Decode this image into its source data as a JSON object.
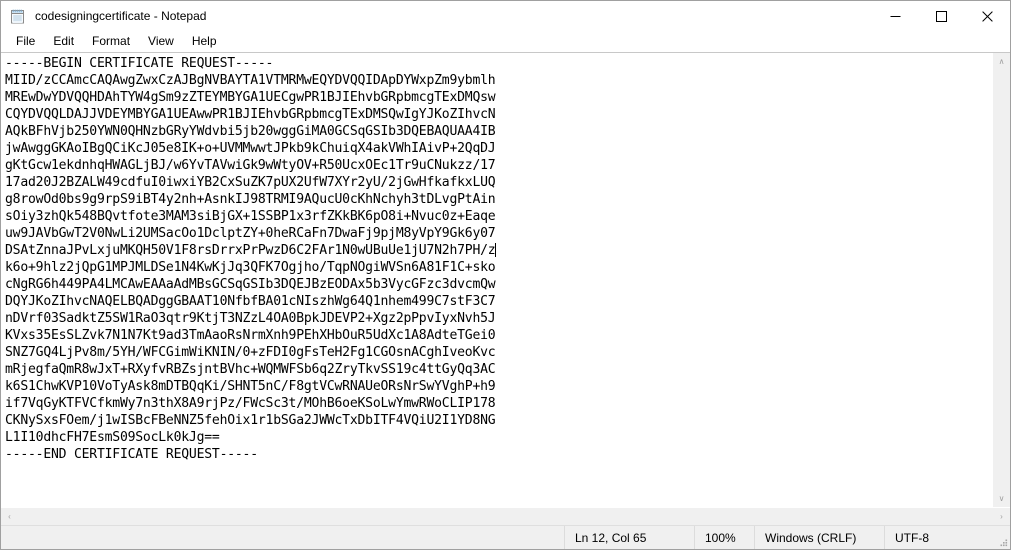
{
  "window": {
    "title": "codesigningcertificate - Notepad",
    "app_icon": "notepad-icon",
    "minimize_label": "Minimize",
    "maximize_label": "Maximize",
    "close_label": "Close"
  },
  "menubar": {
    "items": [
      {
        "label": "File"
      },
      {
        "label": "Edit"
      },
      {
        "label": "Format"
      },
      {
        "label": "View"
      },
      {
        "label": "Help"
      }
    ]
  },
  "editor": {
    "caret_line_index": 12,
    "lines": [
      "-----BEGIN CERTIFICATE REQUEST-----",
      "MIID/zCCAmcCAQAwgZwxCzAJBgNVBAYTA1VTMRMwEQYDVQQIDApDYWxpZm9ybmlh",
      "MREwDwYDVQQHDAhTYW4gSm9zZTEYMBYGA1UECgwPR1BJIEhvbGRpbmcgTExDMQsw",
      "CQYDVQQLDAJJVDEYMBYGA1UEAwwPR1BJIEhvbGRpbmcgTExDMSQwIgYJKoZIhvcN",
      "AQkBFhVjb250YWN0QHNzbGRyYWdvbi5jb20wggGiMA0GCSqGSIb3DQEBAQUAA4IB",
      "jwAwggGKAoIBgQCiKcJ05e8IK+o+UVMMwwtJPkb9kChuiqX4akVWhIAivP+2QqDJ",
      "gKtGcw1ekdnhqHWAGLjBJ/w6YvTAVwiGk9wWtyOV+R50UcxOEc1Tr9uCNukzz/17",
      "17ad20J2BZALW49cdfuI0iwxiYB2CxSuZK7pUX2UfW7XYr2yU/2jGwHfkafkxLUQ",
      "g8rowOd0bs9g9rpS9iBT4y2nh+AsnkIJ98TRMI9AQucU0cKhNchyh3tDLvgPtAin",
      "sOiy3zhQk548BQvtfote3MAM3siBjGX+1SSBP1x3rfZKkBK6pO8i+Nvuc0z+Eaqe",
      "uw9JAVbGwT2V0NwLi2UMSacOo1DclptZY+0heRCaFn7DwaFj9pjM8yVpY9Gk6y07",
      "DSAtZnnaJPvLxjuMKQH50V1F8rsDrrxPrPwzD6C2FAr1N0wUBuUe1jU7N2h7PH/z",
      "k6o+9hlz2jQpG1MPJMLDSe1N4KwKjJq3QFK7Ogjho/TqpNOgiWVSn6A81F1C+sko",
      "cNgRG6h449PA4LMCAwEAAaAdMBsGCSqGSIb3DQEJBzEODAx5b3VycGFzc3dvcmQw",
      "DQYJKoZIhvcNAQELBQADggGBAAT10NfbfBA01cNIszhWg64Q1nhem499C7stF3C7",
      "nDVrf03SadktZ5SW1RaO3qtr9KtjT3NZzL4OA0BpkJDEVP2+Xgz2pPpvIyxNvh5J",
      "KVxs35EsSLZvk7N1N7Kt9ad3TmAaoRsNrmXnh9PEhXHbOuR5UdXc1A8AdteTGei0",
      "SNZ7GQ4LjPv8m/5YH/WFCGimWiKNIN/0+zFDI0gFsTeH2Fg1CGOsnACghIveoKvc",
      "mRjegfaQmR8wJxT+RXyfvRBZsjntBVhc+WQMWFSb6q2ZryTkvSS19c4ttGyQq3AC",
      "k6S1ChwKVP10VoTyAsk8mDTBQqKi/SHNT5nC/F8gtVCwRNAUeORsNrSwYVghP+h9",
      "if7VqGyKTFVCfkmWy7n3thX8A9rjPz/FWcSc3t/MOhB6oeKSoLwYmwRWoCLIP178",
      "CKNySxsFOem/j1wISBcFBeNNZ5fehOix1r1bSGa2JWWcTxDbITF4VQiU2I1YD8NG",
      "L1I10dhcFH7EsmS09SocLk0kJg==",
      "-----END CERTIFICATE REQUEST-----"
    ]
  },
  "scrollbars": {
    "vertical_up_glyph": "∧",
    "vertical_down_glyph": "∨",
    "horizontal_left_glyph": "‹",
    "horizontal_right_glyph": "›"
  },
  "statusbar": {
    "position": "Ln 12, Col 65",
    "zoom": "100%",
    "line_ending": "Windows (CRLF)",
    "encoding": "UTF-8"
  },
  "colors": {
    "window_bg": "#ffffff",
    "chrome_bg": "#f0f0f0",
    "border": "#a0a0a0",
    "text": "#000000",
    "close_hover": "#e81123"
  }
}
